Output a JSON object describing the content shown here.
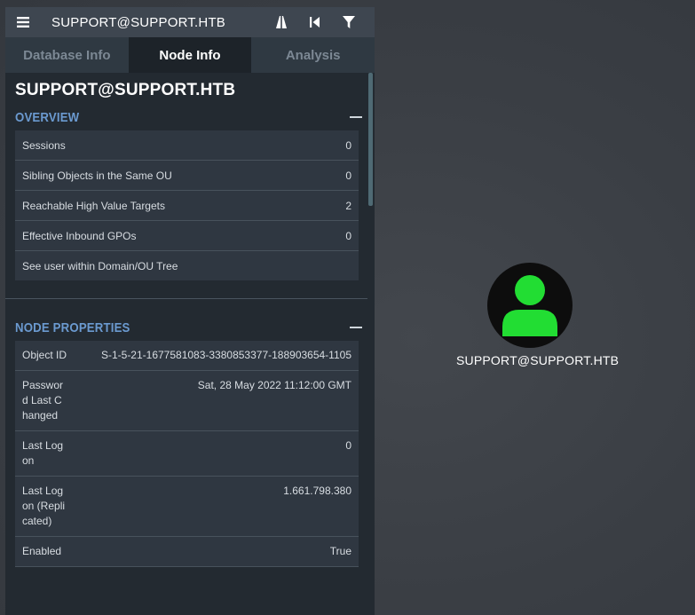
{
  "header": {
    "title": "SUPPORT@SUPPORT.HTB"
  },
  "tabs": [
    {
      "label": "Database Info",
      "active": false
    },
    {
      "label": "Node Info",
      "active": true
    },
    {
      "label": "Analysis",
      "active": false
    }
  ],
  "node": {
    "title": "SUPPORT@SUPPORT.HTB"
  },
  "overview": {
    "title": "OVERVIEW",
    "rows": [
      {
        "label": "Sessions",
        "value": "0"
      },
      {
        "label": "Sibling Objects in the Same OU",
        "value": "0"
      },
      {
        "label": "Reachable High Value Targets",
        "value": "2"
      },
      {
        "label": "Effective Inbound GPOs",
        "value": "0"
      },
      {
        "label": "See user within Domain/OU Tree",
        "value": ""
      }
    ]
  },
  "properties": {
    "title": "NODE PROPERTIES",
    "rows": [
      {
        "key": "Object ID",
        "value": "S-1-5-21-1677581083-3380853377-188903654-1105"
      },
      {
        "key": "Password Last Changed",
        "value": "Sat, 28 May 2022 11:12:00 GMT"
      },
      {
        "key": "Last Logon",
        "value": "0"
      },
      {
        "key": "Last Logon (Replicated)",
        "value": "1.661.798.380"
      },
      {
        "key": "Enabled",
        "value": "True"
      }
    ]
  },
  "graph": {
    "node_label": "SUPPORT@SUPPORT.HTB",
    "node_color": "#22dd33"
  },
  "colors": {
    "accent": "#6b9ad0",
    "panel": "#232a31",
    "topbar": "#3e4650"
  },
  "icons": [
    "menu-icon",
    "path-finding-icon",
    "back-icon",
    "filter-icon",
    "collapse-icon",
    "user-icon"
  ]
}
